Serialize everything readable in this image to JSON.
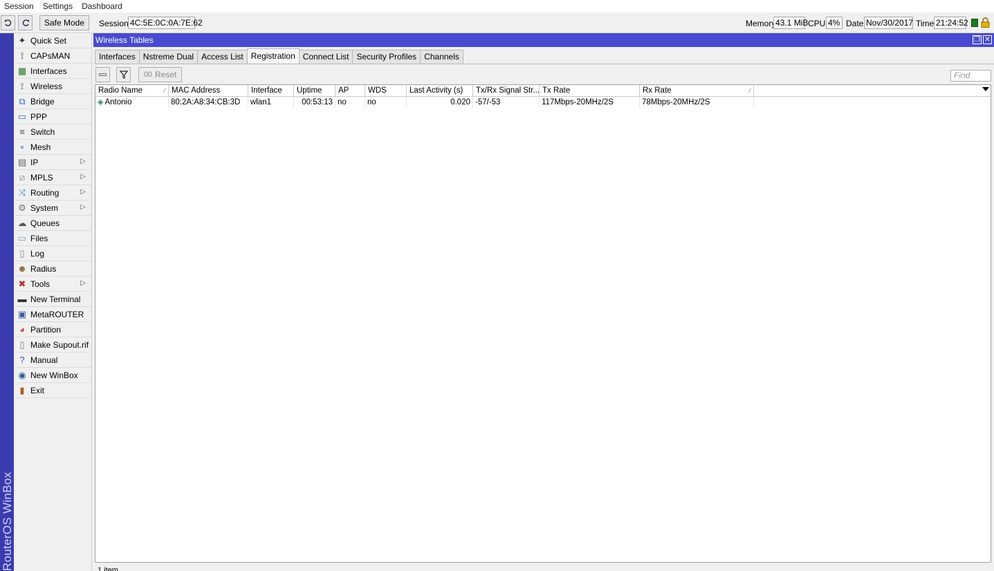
{
  "menubar": {
    "items": [
      "Session",
      "Settings",
      "Dashboard"
    ]
  },
  "toolbar": {
    "undo_icon": "undo-icon",
    "redo_icon": "redo-icon",
    "safe_mode_label": "Safe Mode",
    "session_label": "Session:",
    "session_value": "4C:5E:0C:0A:7E:62",
    "memory_label": "Memory:",
    "memory_value": "43.1 MiB",
    "cpu_label": "CPU:",
    "cpu_value": "4%",
    "date_label": "Date:",
    "date_value": "Nov/30/2017",
    "time_label": "Time:",
    "time_value": "21:24:52",
    "status_color": "#1e7a1e",
    "lock_color": "#e8b400"
  },
  "brand": {
    "text": "RouterOS WinBox",
    "color": "#3b3bb0"
  },
  "sidebar": {
    "items": [
      {
        "label": "Quick Set",
        "icon": "wand-icon",
        "submenu": false
      },
      {
        "label": "CAPsMAN",
        "icon": "antenna-icon",
        "submenu": false
      },
      {
        "label": "Interfaces",
        "icon": "interfaces-icon",
        "submenu": false
      },
      {
        "label": "Wireless",
        "icon": "wireless-icon",
        "submenu": false
      },
      {
        "label": "Bridge",
        "icon": "bridge-icon",
        "submenu": false
      },
      {
        "label": "PPP",
        "icon": "ppp-icon",
        "submenu": false
      },
      {
        "label": "Switch",
        "icon": "switch-icon",
        "submenu": false
      },
      {
        "label": "Mesh",
        "icon": "mesh-icon",
        "submenu": false
      },
      {
        "label": "IP",
        "icon": "ip-icon",
        "submenu": true
      },
      {
        "label": "MPLS",
        "icon": "mpls-icon",
        "submenu": true
      },
      {
        "label": "Routing",
        "icon": "routing-icon",
        "submenu": true
      },
      {
        "label": "System",
        "icon": "gear-icon",
        "submenu": true
      },
      {
        "label": "Queues",
        "icon": "queues-icon",
        "submenu": false
      },
      {
        "label": "Files",
        "icon": "folder-icon",
        "submenu": false
      },
      {
        "label": "Log",
        "icon": "log-icon",
        "submenu": false
      },
      {
        "label": "Radius",
        "icon": "radius-icon",
        "submenu": false
      },
      {
        "label": "Tools",
        "icon": "tools-icon",
        "submenu": true
      },
      {
        "label": "New Terminal",
        "icon": "terminal-icon",
        "submenu": false
      },
      {
        "label": "MetaROUTER",
        "icon": "metarouter-icon",
        "submenu": false
      },
      {
        "label": "Partition",
        "icon": "partition-icon",
        "submenu": false
      },
      {
        "label": "Make Supout.rif",
        "icon": "document-icon",
        "submenu": false
      },
      {
        "label": "Manual",
        "icon": "help-icon",
        "submenu": false
      },
      {
        "label": "New WinBox",
        "icon": "winbox-icon",
        "submenu": false
      },
      {
        "label": "Exit",
        "icon": "exit-icon",
        "submenu": false
      }
    ]
  },
  "window": {
    "title": "Wireless Tables",
    "tabs": [
      "Interfaces",
      "Nstreme Dual",
      "Access List",
      "Registration",
      "Connect List",
      "Security Profiles",
      "Channels"
    ],
    "active_tab": "Registration",
    "reset_label": "Reset",
    "find_placeholder": "Find",
    "columns": [
      "Radio Name",
      "MAC Address",
      "Interface",
      "Uptime",
      "AP",
      "WDS",
      "Last Activity (s)",
      "Tx/Rx Signal Str...",
      "Tx Rate",
      "Rx Rate"
    ],
    "rows": [
      [
        "Antonio",
        "80:2A:A8:34:CB:3D",
        "wlan1",
        "00:53:13",
        "no",
        "no",
        "0.020",
        "-57/-53",
        "117Mbps-20MHz/2S",
        "78Mbps-20MHz/2S"
      ]
    ],
    "status_text": "1 item"
  }
}
